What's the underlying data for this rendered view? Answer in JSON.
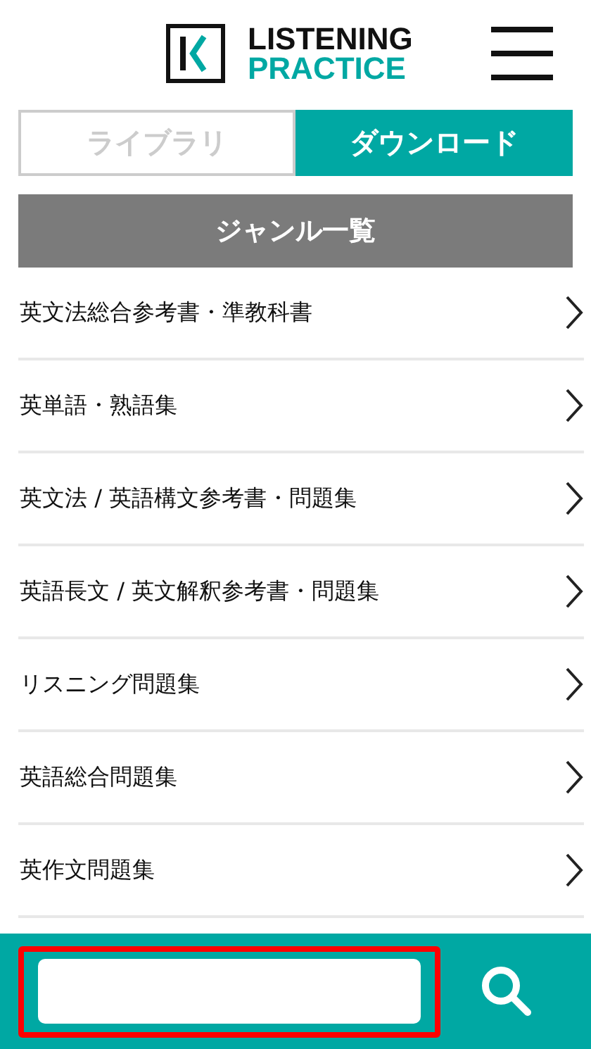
{
  "header": {
    "logo_line1": "LISTENING",
    "logo_line2": "PRACTICE"
  },
  "tabs": [
    {
      "label": "ライブラリ",
      "selected": false
    },
    {
      "label": "ダウンロード",
      "selected": true
    }
  ],
  "section_title": "ジャンル一覧",
  "genres": [
    {
      "label": "英文法総合参考書・準教科書"
    },
    {
      "label": "英単語・熟語集"
    },
    {
      "label": "英文法 / 英語構文参考書・問題集"
    },
    {
      "label": "英語長文 / 英文解釈参考書・問題集"
    },
    {
      "label": "リスニング問題集"
    },
    {
      "label": "英語総合問題集"
    },
    {
      "label": "英作文問題集"
    }
  ],
  "search": {
    "highlighted": true
  }
}
